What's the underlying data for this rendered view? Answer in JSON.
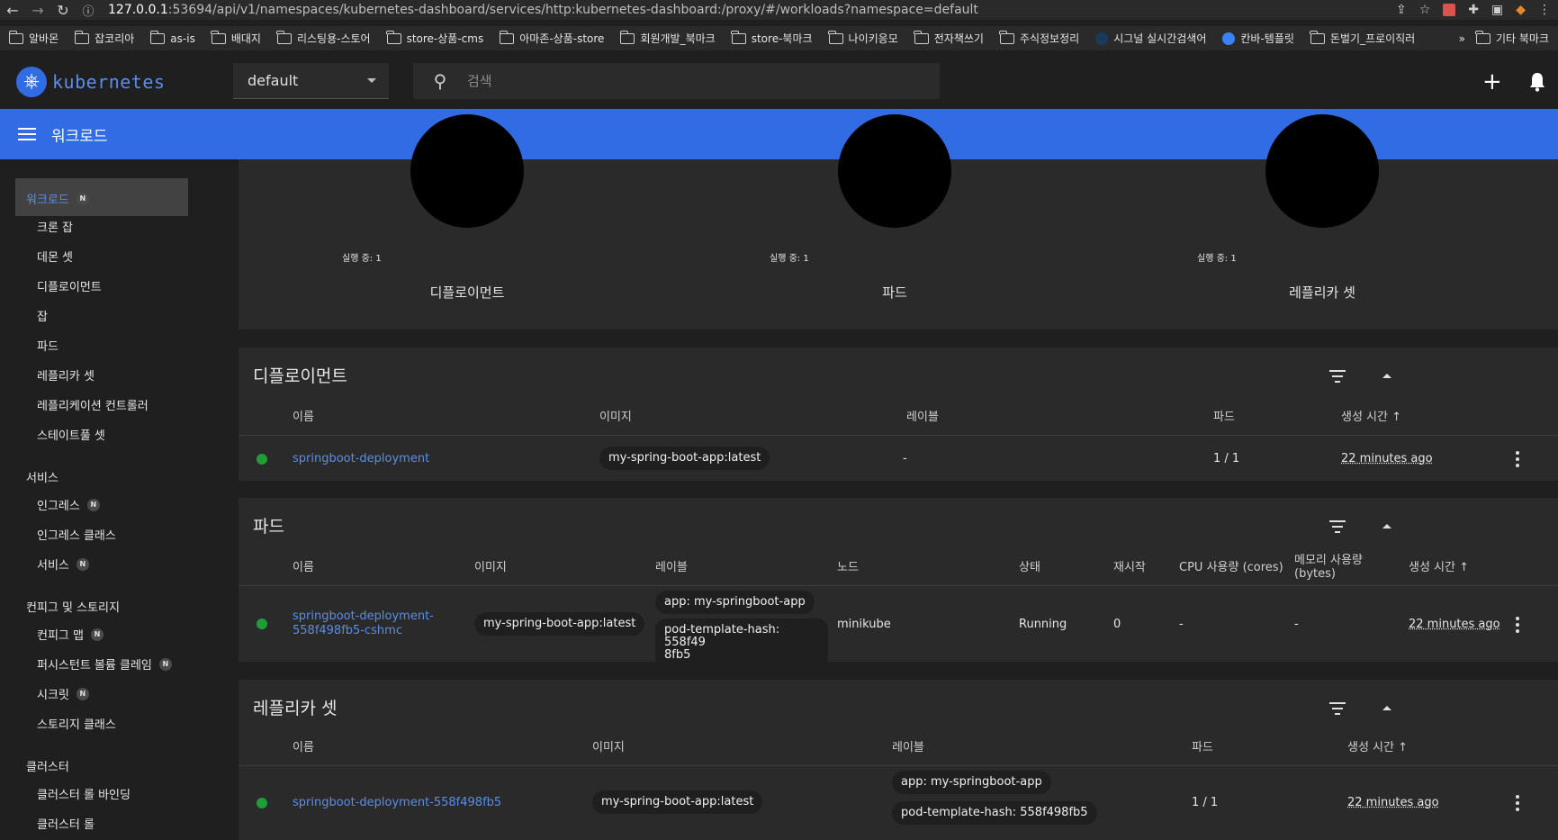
{
  "browser": {
    "url_host": "127.0.0.1",
    "url_rest": ":53694/api/v1/namespaces/kubernetes-dashboard/services/http:kubernetes-dashboard:/proxy/#/workloads?namespace=default",
    "bookmarks": [
      "알바몬",
      "잡코리아",
      "as-is",
      "배대지",
      "리스팅용-스토어",
      "store-상품-cms",
      "아마존-상품-store",
      "회원개발_북마크",
      "store-북마크",
      "나이키응모",
      "전자책쓰기",
      "주식정보정리",
      "시그널 실시간검색어",
      "칸바-템플릿",
      "돈벌기_프로이직러"
    ],
    "more": "»",
    "other_bookmarks": "기타 북마크"
  },
  "header": {
    "brand": "kubernetes",
    "namespace": "default",
    "search_placeholder": "검색"
  },
  "toolbar": {
    "title": "워크로드"
  },
  "sidebar": {
    "workloads": "워크로드",
    "badge": "N",
    "items_workloads": [
      "크론 잡",
      "데몬 셋",
      "디플로이먼트",
      "잡",
      "파드",
      "레플리카 셋",
      "레플리케이션 컨트롤러",
      "스테이트풀 셋"
    ],
    "service_cat": "서비스",
    "items_service": [
      "인그레스",
      "인그레스 클래스",
      "서비스"
    ],
    "config_cat": "컨피그 및 스토리지",
    "items_config": [
      "컨피그 맵",
      "퍼시스턴트 볼륨 클레임",
      "시크릿",
      "스토리지 클래스"
    ],
    "cluster_cat": "클러스터",
    "items_cluster": [
      "클러스터 롤 바인딩",
      "클러스터 롤"
    ]
  },
  "summary": [
    {
      "running": "실행 중: 1",
      "label": "디플로이먼트"
    },
    {
      "running": "실행 중: 1",
      "label": "파드"
    },
    {
      "running": "실행 중: 1",
      "label": "레플리카 셋"
    }
  ],
  "deployments": {
    "title": "디플로이먼트",
    "headers": {
      "name": "이름",
      "image": "이미지",
      "labels": "레이블",
      "pods": "파드",
      "created": "생성 시간 ↑"
    },
    "row": {
      "name": "springboot-deployment",
      "image": "my-spring-boot-app:latest",
      "labels": "-",
      "pods": "1 / 1",
      "created": "22 minutes ago"
    }
  },
  "pods": {
    "title": "파드",
    "headers": {
      "name": "이름",
      "image": "이미지",
      "labels": "레이블",
      "node": "노드",
      "status": "상태",
      "restarts": "재시작",
      "cpu": "CPU 사용량 (cores)",
      "memory_1": "메모리 사용량",
      "memory_2": "(bytes)",
      "created": "생성 시간 ↑"
    },
    "row": {
      "name_1": "springboot-deployment-",
      "name_2": "558f498fb5-cshmc",
      "image": "my-spring-boot-app:latest",
      "label_1": "app: my-springboot-app",
      "label_2a": "pod-template-hash: 558f49",
      "label_2b": "8fb5",
      "node": "minikube",
      "status": "Running",
      "restarts": "0",
      "cpu": "-",
      "memory": "-",
      "created": "22 minutes ago"
    }
  },
  "replicasets": {
    "title": "레플리카 셋",
    "headers": {
      "name": "이름",
      "image": "이미지",
      "labels": "레이블",
      "pods": "파드",
      "created": "생성 시간 ↑"
    },
    "row": {
      "name": "springboot-deployment-558f498fb5",
      "image": "my-spring-boot-app:latest",
      "label_1": "app: my-springboot-app",
      "label_2": "pod-template-hash: 558f498fb5",
      "pods": "1 / 1",
      "created": "22 minutes ago"
    }
  },
  "colors": {
    "accent": "#326ce5",
    "link": "#5b8de8",
    "status_ok": "#1e9e35"
  }
}
